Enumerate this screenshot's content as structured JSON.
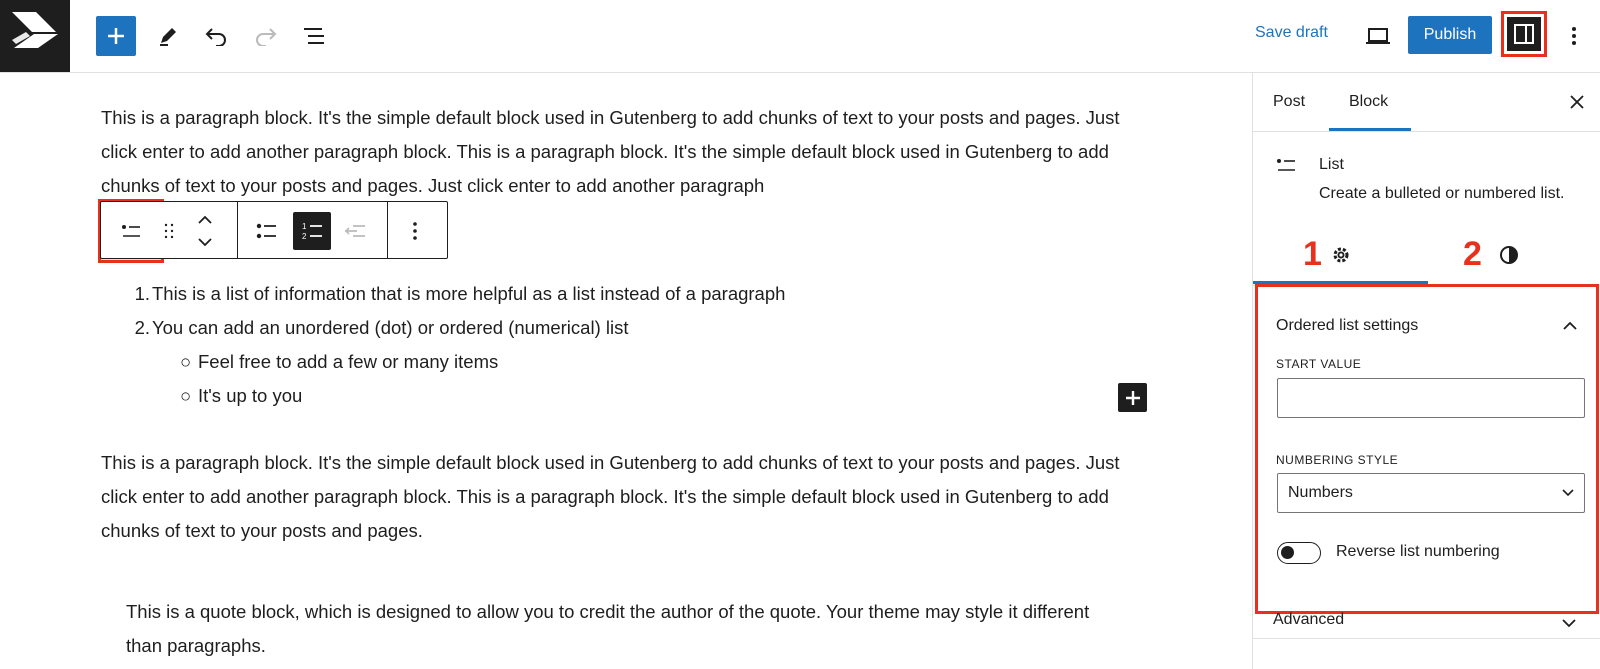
{
  "topbar": {
    "save_draft": "Save draft",
    "publish": "Publish"
  },
  "editor": {
    "paragraph1": "This is a paragraph block. It's the simple default block used in Gutenberg to add chunks of text to your posts and pages. Just click enter to add another paragraph block. This is a paragraph block. It's the simple default block used in Gutenberg to add chunks of text to your posts and pages. Just click enter to add another paragraph",
    "list": {
      "items": [
        "This is a list of information that is more helpful as a list instead of a paragraph",
        "You can add an unordered (dot) or ordered (numerical) list"
      ],
      "subitems": [
        "Feel free to add a few or many items",
        "It's up to you"
      ]
    },
    "paragraph2": "This is a paragraph block. It's the simple default block used in Gutenberg to add chunks of text to your posts and pages. Just click enter to add another paragraph block. This is a paragraph block. It's the simple default block used in Gutenberg to add chunks of text to your posts and pages.",
    "quote": "This is a quote block, which is designed to allow you to credit the author of the quote. Your theme may style it different than paragraphs."
  },
  "sidebar": {
    "tabs": [
      "Post",
      "Block"
    ],
    "active_tab": "Block",
    "block_card": {
      "title": "List",
      "description": "Create a bulleted or numbered list."
    },
    "annotations": [
      "1",
      "2"
    ],
    "panel": {
      "title": "Ordered list settings",
      "start_value_label": "START VALUE",
      "start_value": "",
      "numbering_style_label": "NUMBERING STYLE",
      "numbering_style": "Numbers",
      "reverse_label": "Reverse list numbering",
      "reverse_on": false
    },
    "advanced": "Advanced"
  },
  "colors": {
    "accent": "#1e73be",
    "annotation": "#e8301c",
    "dark": "#1e1e1e"
  }
}
